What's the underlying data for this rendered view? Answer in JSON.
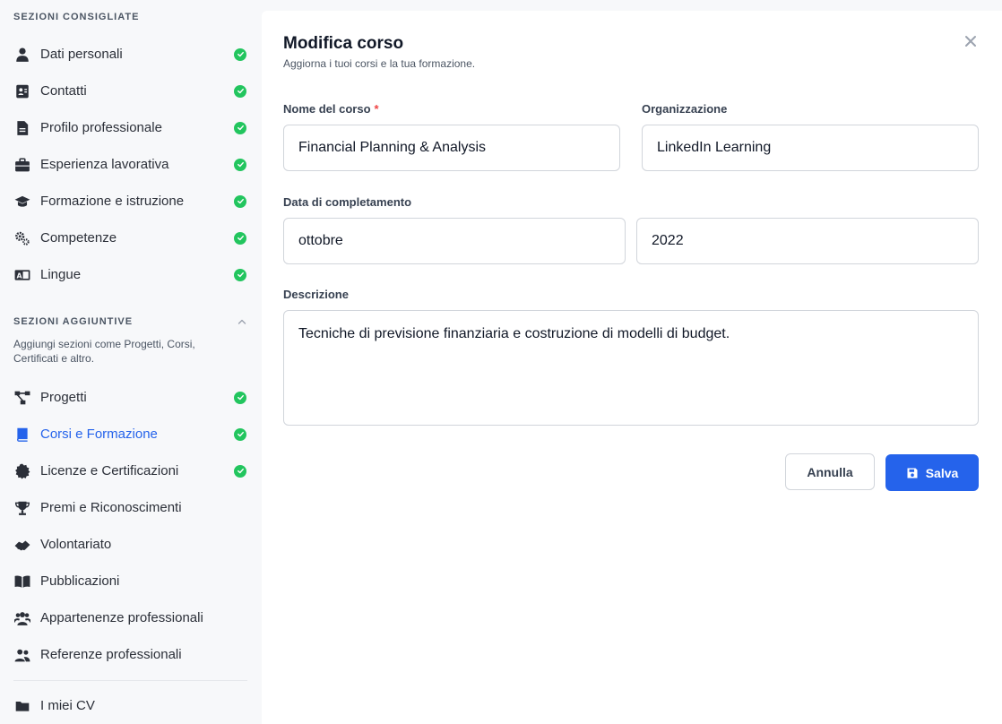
{
  "sidebar": {
    "recommended_title": "SEZIONI CONSIGLIATE",
    "recommended": [
      {
        "label": "Dati personali",
        "icon": "user-icon",
        "done": true
      },
      {
        "label": "Contatti",
        "icon": "address-card-icon",
        "done": true
      },
      {
        "label": "Profilo professionale",
        "icon": "document-icon",
        "done": true
      },
      {
        "label": "Esperienza lavorativa",
        "icon": "briefcase-icon",
        "done": true
      },
      {
        "label": "Formazione e istruzione",
        "icon": "graduation-cap-icon",
        "done": true
      },
      {
        "label": "Competenze",
        "icon": "gears-icon",
        "done": true
      },
      {
        "label": "Lingue",
        "icon": "language-icon",
        "done": true
      }
    ],
    "additional_title": "SEZIONI AGGIUNTIVE",
    "additional_desc": "Aggiungi sezioni come Progetti, Corsi, Certificati e altro.",
    "additional": [
      {
        "label": "Progetti",
        "icon": "project-diagram-icon",
        "done": true
      },
      {
        "label": "Corsi e Formazione",
        "icon": "book-icon",
        "done": true,
        "active": true
      },
      {
        "label": "Licenze e Certificazioni",
        "icon": "certificate-icon",
        "done": true
      },
      {
        "label": "Premi e Riconoscimenti",
        "icon": "trophy-icon",
        "done": false
      },
      {
        "label": "Volontariato",
        "icon": "handshake-icon",
        "done": false
      },
      {
        "label": "Pubblicazioni",
        "icon": "open-book-icon",
        "done": false
      },
      {
        "label": "Appartenenze professionali",
        "icon": "users-icon",
        "done": false
      },
      {
        "label": "Referenze professionali",
        "icon": "user-group-icon",
        "done": false
      }
    ],
    "footer": {
      "label": "I miei CV",
      "icon": "folder-icon"
    }
  },
  "modal": {
    "title": "Modifica corso",
    "subtitle": "Aggiorna i tuoi corsi e la tua formazione.",
    "course_name_label": "Nome del corso",
    "required_mark": "*",
    "course_name_value": "Financial Planning & Analysis",
    "organization_label": "Organizzazione",
    "organization_value": "LinkedIn Learning",
    "completion_label": "Data di completamento",
    "month_value": "ottobre",
    "year_value": "2022",
    "description_label": "Descrizione",
    "description_value": "Tecniche di previsione finanziaria e costruzione di modelli di budget.",
    "cancel_label": "Annulla",
    "save_label": "Salva"
  },
  "colors": {
    "accent": "#2563eb",
    "success": "#22c55e",
    "required": "#ef4444"
  }
}
